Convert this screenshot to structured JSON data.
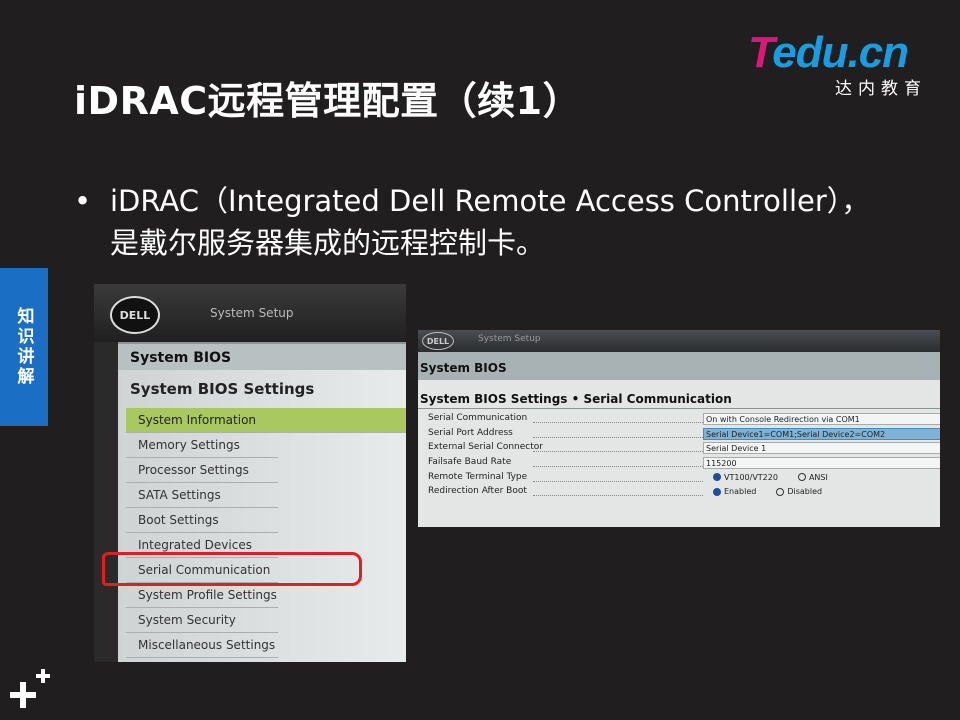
{
  "slide": {
    "title": "iDRAC远程管理配置（续1）",
    "bullet_line1": "iDRAC（Integrated Dell Remote Access Controller），",
    "bullet_line2": "是戴尔服务器集成的远程控制卡。",
    "side_tab": "知识讲解",
    "accent_color": "#1a6fc4"
  },
  "logo": {
    "t": "T",
    "rest": "edu.cn",
    "subtitle": "达内教育",
    "pink": "#e0157a",
    "blue": "#1a9de0"
  },
  "bios_menu": {
    "brand": "DELL",
    "setup_title": "System Setup",
    "bios_bar": "System BIOS",
    "settings_title": "System BIOS Settings",
    "items": [
      {
        "label": "System Information"
      },
      {
        "label": "Memory Settings"
      },
      {
        "label": "Processor Settings"
      },
      {
        "label": "SATA Settings"
      },
      {
        "label": "Boot Settings"
      },
      {
        "label": "Integrated Devices"
      },
      {
        "label": "Serial Communication"
      },
      {
        "label": "System Profile Settings"
      },
      {
        "label": "System Security"
      },
      {
        "label": "Miscellaneous Settings"
      }
    ],
    "highlight_color": "#a9c860",
    "circled_item": "Serial Communication"
  },
  "serial_comm": {
    "brand": "DELL",
    "setup_title": "System Setup",
    "bios_bar": "System BIOS",
    "title": "System BIOS Settings • Serial Communication",
    "rows": [
      {
        "label": "Serial Communication",
        "value": "On with Console Redirection via COM1"
      },
      {
        "label": "Serial Port Address",
        "value": "Serial Device1=COM1;Serial Device2=COM2"
      },
      {
        "label": "External Serial Connector",
        "value": "Serial Device 1"
      },
      {
        "label": "Failsafe Baud Rate",
        "value": "115200"
      },
      {
        "label": "Remote Terminal Type",
        "options": [
          "VT100/VT220",
          "ANSI"
        ],
        "selected": "VT100/VT220"
      },
      {
        "label": "Redirection After Boot",
        "options": [
          "Enabled",
          "Disabled"
        ],
        "selected": "Enabled"
      }
    ]
  }
}
